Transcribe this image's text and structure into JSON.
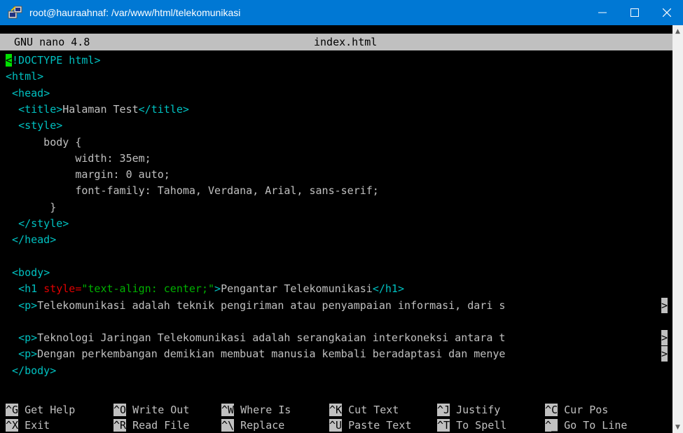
{
  "window": {
    "title": "root@hauraahnaf: /var/www/html/telekomunikasi",
    "controls": [
      "minimize-icon",
      "maximize-icon",
      "close-icon"
    ],
    "accent_color": "#0078d4"
  },
  "nano": {
    "version": "GNU nano 4.8",
    "filename": "index.html"
  },
  "editor": {
    "lines": [
      "<!DOCTYPE html>",
      "<html>",
      " <head>",
      "  <title>Halaman Test</title>",
      "  <style>",
      "      body {",
      "           width: 35em;",
      "           margin: 0 auto;",
      "           font-family: Tahoma, Verdana, Arial, sans-serif;",
      "       }",
      "  </style>",
      " </head>",
      "",
      " <body>",
      "  <h1 style=\"text-align: center;\">Pengantar Telekomunikasi</h1>",
      "  <p>Telekomunikasi adalah teknik pengiriman atau penyampaian informasi, dari s",
      "",
      "  <p>Teknologi Jaringan Telekomunikasi adalah serangkaian interkoneksi antara t",
      "  <p>Dengan perkembangan demikian membuat manusia kembali beradaptasi dan menye",
      " </body>"
    ],
    "truncation_marker": ">"
  },
  "shortcuts": {
    "row1": [
      {
        "key": "^G",
        "label": "Get Help"
      },
      {
        "key": "^O",
        "label": "Write Out"
      },
      {
        "key": "^W",
        "label": "Where Is"
      },
      {
        "key": "^K",
        "label": "Cut Text"
      },
      {
        "key": "^J",
        "label": "Justify"
      },
      {
        "key": "^C",
        "label": "Cur Pos"
      }
    ],
    "row2": [
      {
        "key": "^X",
        "label": "Exit"
      },
      {
        "key": "^R",
        "label": "Read File"
      },
      {
        "key": "^\\",
        "label": "Replace"
      },
      {
        "key": "^U",
        "label": "Paste Text"
      },
      {
        "key": "^T",
        "label": "To Spell"
      },
      {
        "key": "^_",
        "label": "Go To Line"
      }
    ]
  }
}
